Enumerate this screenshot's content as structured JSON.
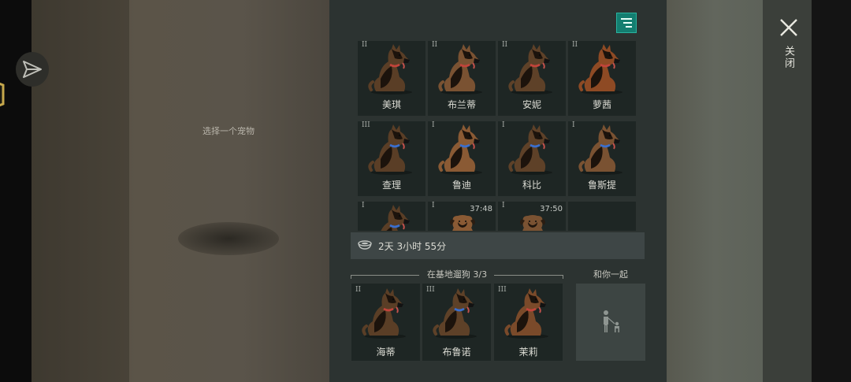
{
  "scene": {
    "select_prompt": "选择一个宠物"
  },
  "controls": {
    "close_label": "关闭",
    "filter_icon": "filter-list-icon",
    "send_icon": "paper-plane-icon"
  },
  "pet_grid": [
    {
      "name": "美琪",
      "tier": "II",
      "collar": "#c2443b",
      "coat": "#5a3e26"
    },
    {
      "name": "布兰蒂",
      "tier": "II",
      "collar": "#c2443b",
      "coat": "#7a5232"
    },
    {
      "name": "安妮",
      "tier": "II",
      "collar": "#c2443b",
      "coat": "#5e4128"
    },
    {
      "name": "萝茜",
      "tier": "II",
      "collar": "#c2443b",
      "coat": "#8e4a24"
    },
    {
      "name": "查理",
      "tier": "III",
      "collar": "#3a6fcf",
      "coat": "#5a3e26"
    },
    {
      "name": "鲁迪",
      "tier": "I",
      "collar": "#3a6fcf",
      "coat": "#8a5a34"
    },
    {
      "name": "科比",
      "tier": "I",
      "collar": "#3a6fcf",
      "coat": "#5e4128"
    },
    {
      "name": "鲁斯提",
      "tier": "I",
      "collar": "#3a6fcf",
      "coat": "#7a5232"
    },
    {
      "name": "",
      "tier": "I",
      "timer": "",
      "collar": "#3a6fcf",
      "coat": "#5a3e26",
      "kind": "adult"
    },
    {
      "name": "",
      "tier": "I",
      "timer": "37:48",
      "collar": "#3a6fcf",
      "coat": "#8a5a34",
      "kind": "puppy"
    },
    {
      "name": "",
      "tier": "I",
      "timer": "37:50",
      "collar": "#3a6fcf",
      "coat": "#7a5232",
      "kind": "puppy"
    },
    {
      "name": "",
      "tier": "",
      "timer": "",
      "kind": "empty"
    }
  ],
  "timer_bar": {
    "icon": "food-bowl-icon",
    "text": "2天 3小时 55分"
  },
  "base": {
    "header": "在基地遛狗 3/3",
    "dogs": [
      {
        "name": "海蒂",
        "tier": "II",
        "collar": "#c2443b",
        "coat": "#5a3e26"
      },
      {
        "name": "布鲁诺",
        "tier": "III",
        "collar": "#3a6fcf",
        "coat": "#5e4128"
      },
      {
        "name": "茉莉",
        "tier": "III",
        "collar": "#c2443b",
        "coat": "#7a4a2a"
      }
    ]
  },
  "companion": {
    "label": "和你一起",
    "icon": "person-with-dog-icon"
  }
}
